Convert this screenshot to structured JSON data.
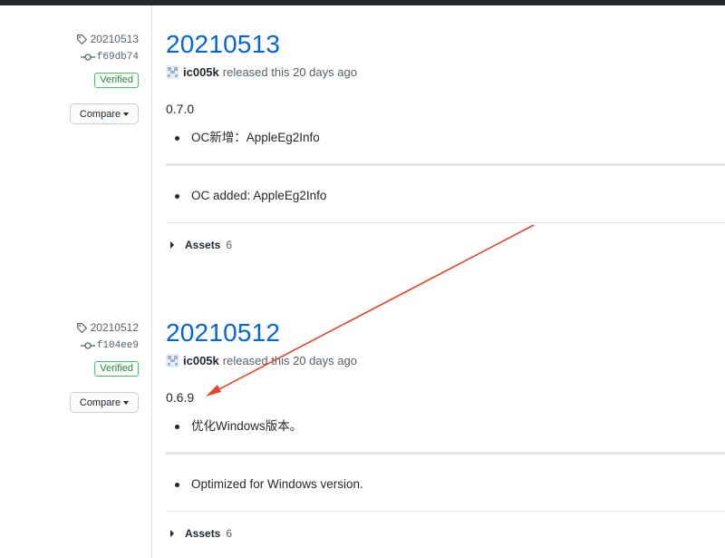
{
  "releases": [
    {
      "tag": "20210513",
      "commit": "f69db74",
      "verified": "Verified",
      "compare_label": "Compare",
      "title": "20210513",
      "author": "ic005k",
      "released_text": "released this 20 days ago",
      "version": "0.7.0",
      "notes_cn": [
        "OC新增：AppleEg2Info"
      ],
      "notes_en": [
        "OC added: AppleEg2Info"
      ],
      "assets_label": "Assets",
      "assets_count": "6"
    },
    {
      "tag": "20210512",
      "commit": "f104ee9",
      "verified": "Verified",
      "compare_label": "Compare",
      "title": "20210512",
      "author": "ic005k",
      "released_text": "released this 20 days ago",
      "version": "0.6.9",
      "notes_cn": [
        "优化Windows版本。"
      ],
      "notes_en": [
        "Optimized for Windows version."
      ],
      "assets_label": "Assets",
      "assets_count": "6"
    }
  ],
  "colors": {
    "link": "#0366d6",
    "verified": "#22863a",
    "annotation_arrow": "#e8442a"
  },
  "icons": [
    "tag-icon",
    "commit-icon",
    "avatar-icon",
    "caret-down-icon",
    "triangle-right-icon",
    "arrow-annotation"
  ]
}
